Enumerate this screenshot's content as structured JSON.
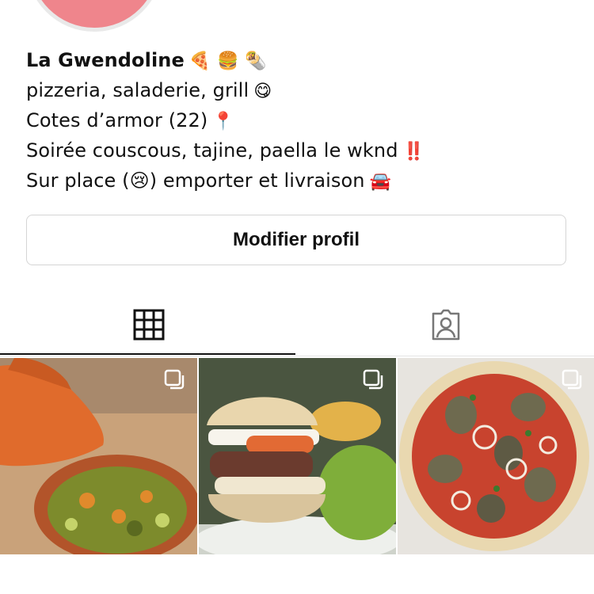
{
  "profile": {
    "bio_lines": [
      {
        "text": "La Gwendoline",
        "emoji": "🍕 🍔 🌯"
      },
      {
        "text": "pizzeria, saladerie, grill",
        "emoji": "😋"
      },
      {
        "text": "Cotes d’armor (22)",
        "emoji": "📍"
      },
      {
        "text": "Soirée couscous, tajine, paella le wknd",
        "emoji": "‼️"
      },
      {
        "text": "Sur place (😢) emporter et livraison",
        "emoji": "🚘"
      }
    ],
    "edit_button_label": "Modifier profil"
  },
  "tabs": [
    {
      "name": "posts-grid",
      "icon": "grid-icon",
      "active": true
    },
    {
      "name": "tagged",
      "icon": "tagged-person-icon",
      "active": false
    }
  ],
  "posts": [
    {
      "subject": "tajine",
      "icon": "multiple-photos-icon"
    },
    {
      "subject": "burger",
      "icon": "multiple-photos-icon"
    },
    {
      "subject": "pizza",
      "icon": "multiple-photos-icon"
    }
  ],
  "colors": {
    "avatar": "#ef858c",
    "border": "#d5d5d5",
    "active_tab": "#111111"
  }
}
